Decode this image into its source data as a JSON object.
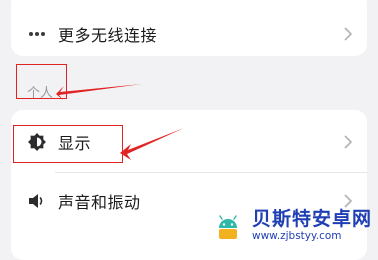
{
  "more_wireless": {
    "label": "更多无线连接",
    "icon": "more-dots-icon"
  },
  "section_personal": {
    "title": "个人"
  },
  "display": {
    "label": "显示",
    "icon": "brightness-icon"
  },
  "sound": {
    "label": "声音和振动",
    "icon": "speaker-icon"
  },
  "watermark": {
    "title": "贝斯特安卓网",
    "url": "www.zjbstyy.com"
  },
  "colors": {
    "annotation": "#e02424",
    "watermark": "#1f3fb3"
  }
}
